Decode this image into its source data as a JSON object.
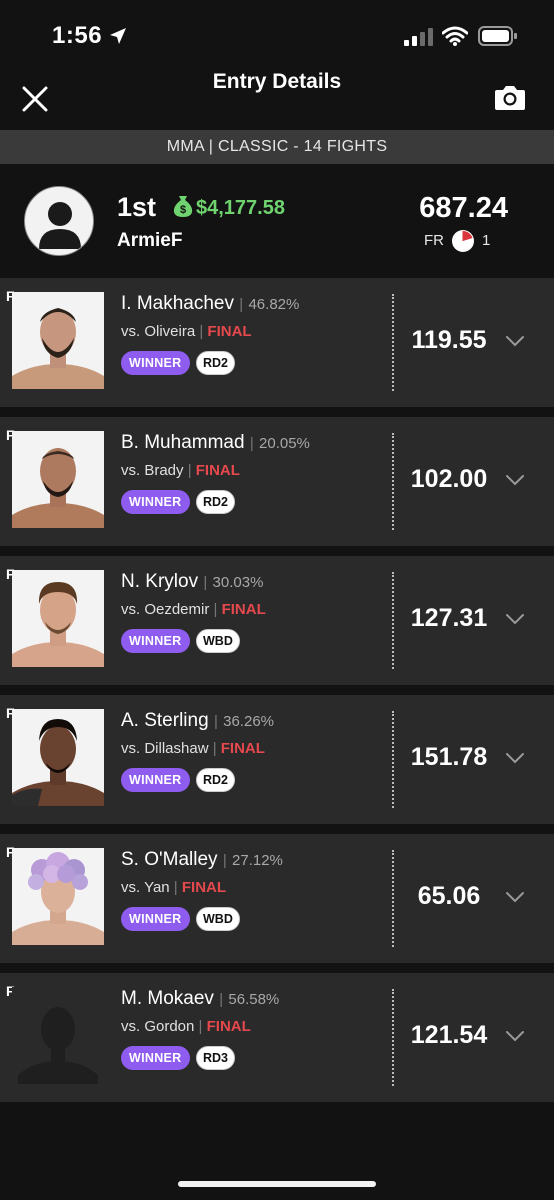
{
  "status": {
    "time": "1:56"
  },
  "header": {
    "title": "Entry Details"
  },
  "contest": {
    "label": "MMA | CLASSIC - 14 FIGHTS"
  },
  "entry": {
    "rank": "1st",
    "winnings": "$4,177.58",
    "username": "ArmieF",
    "total_points": "687.24",
    "fr_label": "FR",
    "fr_count": "1"
  },
  "fights": [
    {
      "f": "F",
      "name": "I. Makhachev",
      "pct": "46.82%",
      "vs": "vs. Oliveira",
      "status": "FINAL",
      "result": "WINNER",
      "round": "RD2",
      "points": "119.55",
      "photo": "makhachev-photo"
    },
    {
      "f": "F",
      "name": "B. Muhammad",
      "pct": "20.05%",
      "vs": "vs. Brady",
      "status": "FINAL",
      "result": "WINNER",
      "round": "RD2",
      "points": "102.00",
      "photo": "muhammad-photo"
    },
    {
      "f": "F",
      "name": "N. Krylov",
      "pct": "30.03%",
      "vs": "vs. Oezdemir",
      "status": "FINAL",
      "result": "WINNER",
      "round": "WBD",
      "points": "127.31",
      "photo": "krylov-photo"
    },
    {
      "f": "F",
      "name": "A. Sterling",
      "pct": "36.26%",
      "vs": "vs. Dillashaw",
      "status": "FINAL",
      "result": "WINNER",
      "round": "RD2",
      "points": "151.78",
      "photo": "sterling-photo"
    },
    {
      "f": "F",
      "name": "S. O'Malley",
      "pct": "27.12%",
      "vs": "vs. Yan",
      "status": "FINAL",
      "result": "WINNER",
      "round": "WBD",
      "points": "65.06",
      "photo": "omalley-photo"
    },
    {
      "f": "F",
      "name": "M. Mokaev",
      "pct": "56.58%",
      "vs": "vs. Gordon",
      "status": "FINAL",
      "result": "WINNER",
      "round": "RD3",
      "points": "121.54",
      "photo": "silhouette-placeholder"
    }
  ],
  "colors": {
    "background": "#121212",
    "row_background": "#2a2a2a",
    "winner_badge": "#8f5cf0",
    "final_text": "#e5484d",
    "winnings_text": "#6fd36f"
  }
}
